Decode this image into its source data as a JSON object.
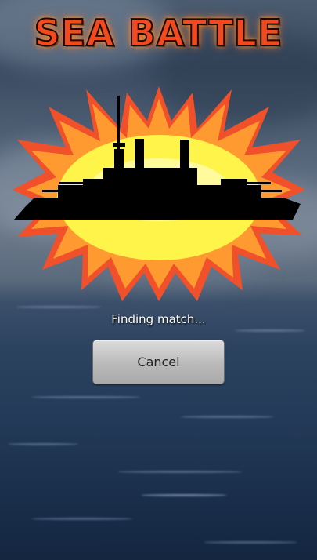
{
  "game": {
    "title": "SEA BATTLE",
    "status_text": "Finding match...",
    "cancel_label": "Cancel"
  },
  "colors": {
    "title_fill": "#f24a1e",
    "burst_outer": "#f0502a",
    "burst_mid": "#ff9a30",
    "burst_inner": "#fff44a",
    "ship": "#000000",
    "button_face": "#bcbcbc"
  },
  "icons": {
    "emblem": "battleship-explosion-icon"
  }
}
